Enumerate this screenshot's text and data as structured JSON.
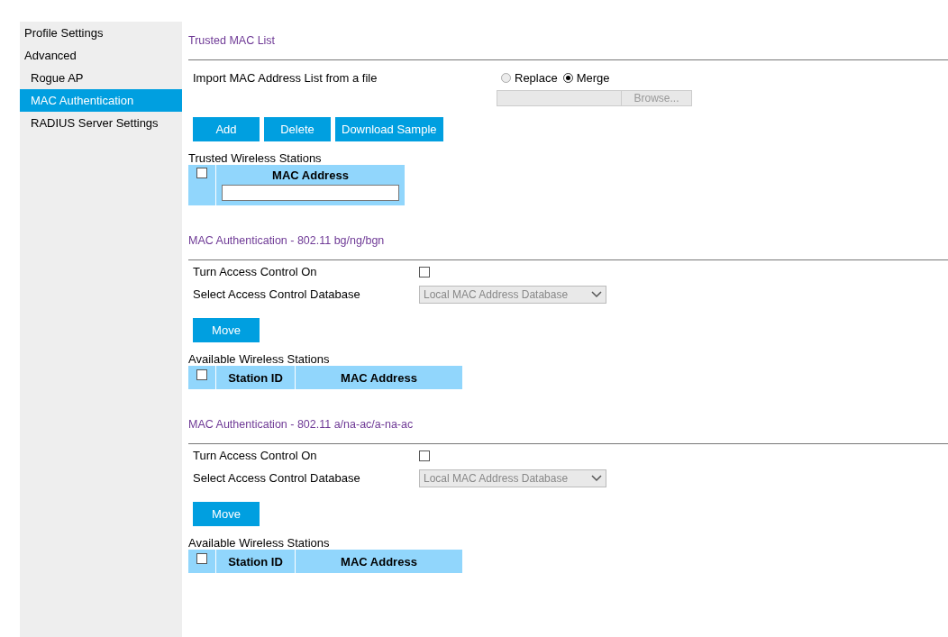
{
  "sidebar": {
    "items": [
      {
        "label": "Profile Settings",
        "selected": false
      },
      {
        "label": "Advanced",
        "selected": false,
        "children": [
          {
            "label": "Rogue AP",
            "selected": false
          },
          {
            "label": "MAC Authentication",
            "selected": true
          },
          {
            "label": "RADIUS Server Settings",
            "selected": false
          }
        ]
      }
    ]
  },
  "trusted": {
    "title": "Trusted MAC List",
    "import_label": "Import MAC Address List from a file",
    "import_modes": [
      {
        "label": "Replace",
        "selected": false
      },
      {
        "label": "Merge",
        "selected": true
      }
    ],
    "browse_button": "Browse...",
    "buttons": [
      "Add",
      "Delete",
      "Download Sample"
    ],
    "table_caption": "Trusted Wireless Stations",
    "table_columns": [
      "MAC Address"
    ],
    "select_all_checked": false
  },
  "sections": [
    {
      "title": "MAC Authentication - 802.11 bg/ng/bgn",
      "access_label": "Turn Access Control On",
      "access_on": false,
      "database_label": "Select Access Control Database",
      "database_value": "Local MAC Address Database",
      "move_button": "Move",
      "table_caption": "Available Wireless Stations",
      "table_columns": [
        "Station ID",
        "MAC Address"
      ],
      "select_all_checked": false
    },
    {
      "title": "MAC Authentication - 802.11 a/na-ac/a-na-ac",
      "access_label": "Turn Access Control On",
      "access_on": false,
      "database_label": "Select Access Control Database",
      "database_value": "Local MAC Address Database",
      "move_button": "Move",
      "table_caption": "Available Wireless Stations",
      "table_columns": [
        "Station ID",
        "MAC Address"
      ],
      "select_all_checked": false
    }
  ]
}
